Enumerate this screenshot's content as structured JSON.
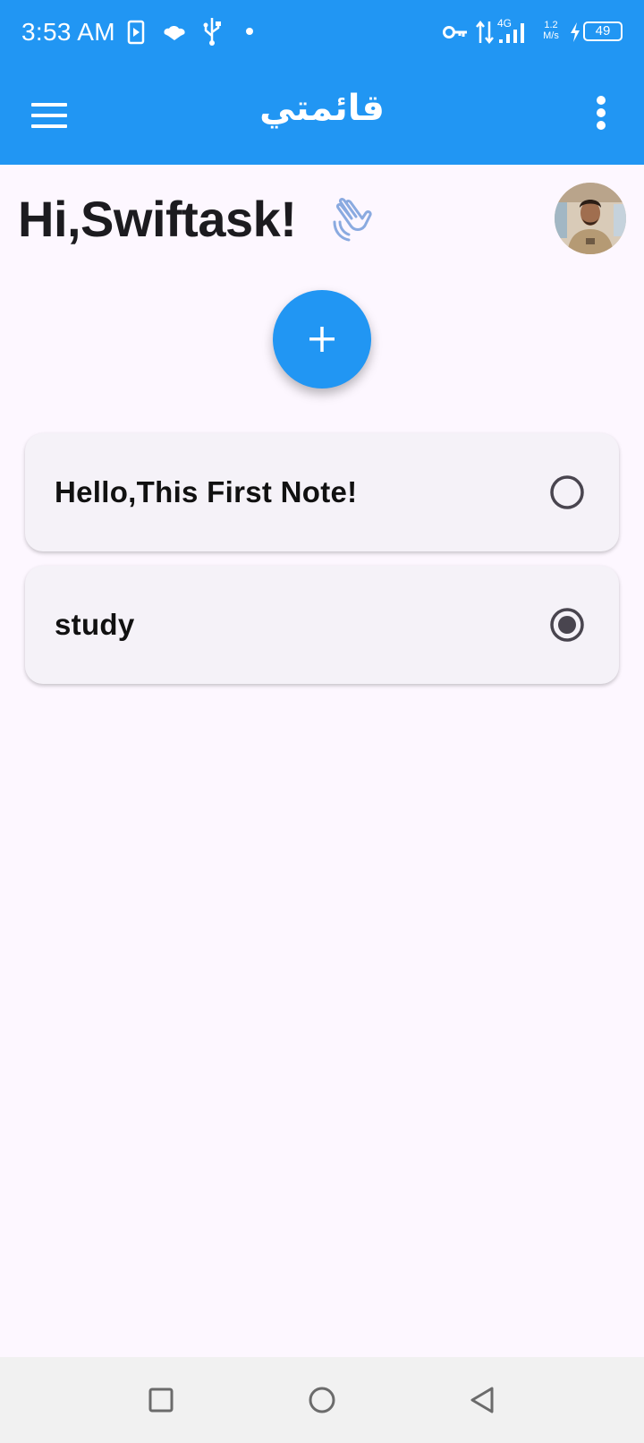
{
  "status_bar": {
    "time": "3:53 AM",
    "network_type": "4G",
    "speed_value": "1.2",
    "speed_unit": "M/s",
    "battery": "49",
    "icons": [
      "screen-record-icon",
      "cloud-icon",
      "usb-icon",
      "dot-icon",
      "vpn-key-icon",
      "data-arrows-icon",
      "signal-icon",
      "charging-icon",
      "battery-icon"
    ]
  },
  "app_bar": {
    "title": "قائمتي",
    "menu_icon": "hamburger-menu-icon",
    "more_icon": "more-vert-icon"
  },
  "greeting": {
    "text": "Hi,Swiftask!",
    "icon": "waving-hand-icon"
  },
  "fab": {
    "icon": "plus-icon"
  },
  "tasks": [
    {
      "title": "Hello,This First Note!",
      "done": false
    },
    {
      "title": "study",
      "done": true
    }
  ],
  "nav_bar": {
    "icons": [
      "recent-apps-icon",
      "home-icon",
      "back-icon"
    ]
  },
  "colors": {
    "primary": "#2196f3",
    "background": "#fdf7ff",
    "card": "#f5f2f8",
    "radio": "#49454f"
  }
}
